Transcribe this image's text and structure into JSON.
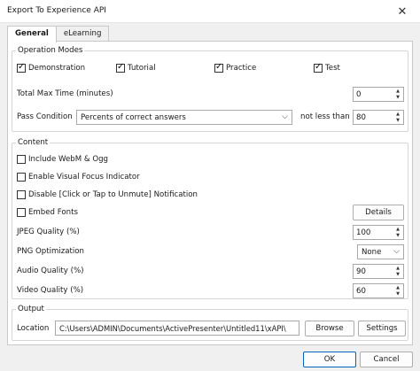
{
  "window": {
    "title": "Export To Experience API",
    "close_glyph": "✕"
  },
  "tabs": [
    {
      "label": "General"
    },
    {
      "label": "eLearning"
    }
  ],
  "operation_modes": {
    "title": "Operation Modes",
    "items": [
      {
        "label": "Demonstration",
        "checked": true
      },
      {
        "label": "Tutorial",
        "checked": true
      },
      {
        "label": "Practice",
        "checked": true
      },
      {
        "label": "Test",
        "checked": true
      }
    ],
    "total_max_time_label": "Total Max Time (minutes)",
    "total_max_time_value": "0",
    "pass_condition_label": "Pass Condition",
    "pass_condition_value": "Percents of correct answers",
    "not_less_than_label": "not less than",
    "not_less_than_value": "80"
  },
  "content": {
    "title": "Content",
    "checkboxes": [
      {
        "label": "Include WebM & Ogg",
        "checked": false
      },
      {
        "label": "Enable Visual Focus Indicator",
        "checked": false
      },
      {
        "label": "Disable [Click or Tap to Unmute] Notification",
        "checked": false
      },
      {
        "label": "Embed Fonts",
        "checked": false
      }
    ],
    "details_button": "Details",
    "jpeg_quality_label": "JPEG Quality (%)",
    "jpeg_quality_value": "100",
    "png_optimization_label": "PNG Optimization",
    "png_optimization_value": "None",
    "audio_quality_label": "Audio Quality (%)",
    "audio_quality_value": "90",
    "video_quality_label": "Video Quality (%)",
    "video_quality_value": "60"
  },
  "output": {
    "title": "Output",
    "location_label": "Location",
    "location_value": "C:\\Users\\ADMIN\\Documents\\ActivePresenter\\Untitled11\\xAPI\\",
    "browse_button": "Browse",
    "settings_button": "Settings"
  },
  "footer": {
    "ok_button": "OK",
    "cancel_button": "Cancel"
  }
}
